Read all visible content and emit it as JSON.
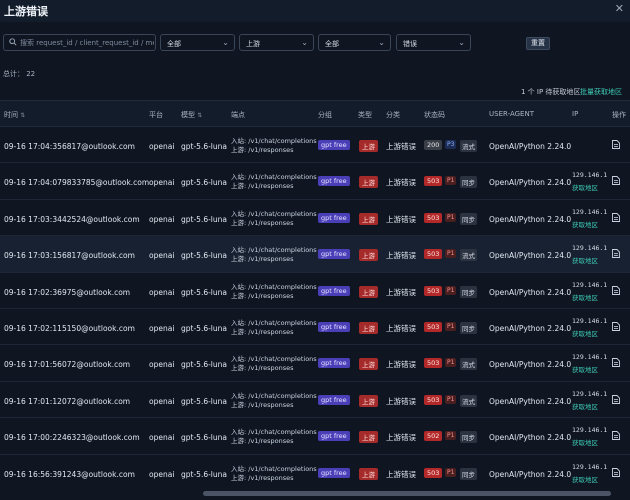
{
  "title": "上游错误",
  "filters": {
    "search_placeholder": "搜索 request_id / client_request_id / message",
    "select1": "全部",
    "select2": "上游",
    "select3": "全部",
    "select4": "错误",
    "reset_label": "重置"
  },
  "summary": {
    "total": "总计： 22",
    "ip_note": "1 个 IP 待获取地区",
    "batch_link": "批量获取地区"
  },
  "columns": {
    "time": "时间",
    "platform": "平台",
    "model": "模型",
    "endpoint": "端点",
    "group": "分组",
    "type": "类型",
    "category": "分类",
    "status": "状态码",
    "ua": "USER-AGENT",
    "ip": "IP",
    "ops": "操作"
  },
  "rows": [
    {
      "time": "09-16 17:04:35",
      "email": "6817@outlook.com",
      "platform": "openai",
      "model": "gpt-5.6-luna",
      "ep_in": "入站: /v1/chat/completions",
      "ep_up": "上游: /v1/responses",
      "group": "gpt free",
      "type": "上游",
      "category": "上游错误",
      "code": "200",
      "priority": "P3",
      "mode": "流式",
      "ua": "OpenAI/Python 2.24.0",
      "ip": "",
      "geo": ""
    },
    {
      "time": "09-16 17:04:07",
      "email": "9833785@outlook.com",
      "platform": "openai",
      "model": "gpt-5.6-luna",
      "ep_in": "入站: /v1/chat/completions",
      "ep_up": "上游: /v1/responses",
      "group": "gpt free",
      "type": "上游",
      "category": "上游错误",
      "code": "503",
      "priority": "P1",
      "mode": "同步",
      "ua": "OpenAI/Python 2.24.0",
      "ip": "129.146.1",
      "geo": "获取地区"
    },
    {
      "time": "09-16 17:03:34",
      "email": "42524@outlook.com",
      "platform": "openai",
      "model": "gpt-5.6-luna",
      "ep_in": "入站: /v1/chat/completions",
      "ep_up": "上游: /v1/responses",
      "group": "gpt free",
      "type": "上游",
      "category": "上游错误",
      "code": "503",
      "priority": "P1",
      "mode": "同步",
      "ua": "OpenAI/Python 2.24.0",
      "ip": "129.146.1",
      "geo": "获取地区"
    },
    {
      "time": "09-16 17:03:15",
      "email": "6817@outlook.com",
      "platform": "openai",
      "model": "gpt-5.6-luna",
      "ep_in": "入站: /v1/chat/completions",
      "ep_up": "上游: /v1/responses",
      "group": "gpt free",
      "type": "上游",
      "category": "上游错误",
      "code": "503",
      "priority": "P1",
      "mode": "流式",
      "ua": "OpenAI/Python 2.24.0",
      "ip": "129.146.1",
      "geo": "获取地区"
    },
    {
      "time": "09-16 17:02:36",
      "email": "975@outlook.com",
      "platform": "openai",
      "model": "gpt-5.6-luna",
      "ep_in": "入站: /v1/chat/completions",
      "ep_up": "上游: /v1/responses",
      "group": "gpt free",
      "type": "上游",
      "category": "上游错误",
      "code": "503",
      "priority": "P1",
      "mode": "同步",
      "ua": "OpenAI/Python 2.24.0",
      "ip": "129.146.1",
      "geo": "获取地区"
    },
    {
      "time": "09-16 17:02:11",
      "email": "5150@outlook.com",
      "platform": "openai",
      "model": "gpt-5.6-luna",
      "ep_in": "入站: /v1/chat/completions",
      "ep_up": "上游: /v1/responses",
      "group": "gpt free",
      "type": "上游",
      "category": "上游错误",
      "code": "503",
      "priority": "P1",
      "mode": "同步",
      "ua": "OpenAI/Python 2.24.0",
      "ip": "129.146.1",
      "geo": "获取地区"
    },
    {
      "time": "09-16 17:01:56",
      "email": "072@outlook.com",
      "platform": "openai",
      "model": "gpt-5.6-luna",
      "ep_in": "入站: /v1/chat/completions",
      "ep_up": "上游: /v1/responses",
      "group": "gpt free",
      "type": "上游",
      "category": "上游错误",
      "code": "503",
      "priority": "P1",
      "mode": "流式",
      "ua": "OpenAI/Python 2.24.0",
      "ip": "129.146.1",
      "geo": "获取地区"
    },
    {
      "time": "09-16 17:01:12",
      "email": "072@outlook.com",
      "platform": "openai",
      "model": "gpt-5.6-luna",
      "ep_in": "入站: /v1/chat/completions",
      "ep_up": "上游: /v1/responses",
      "group": "gpt free",
      "type": "上游",
      "category": "上游错误",
      "code": "503",
      "priority": "P1",
      "mode": "流式",
      "ua": "OpenAI/Python 2.24.0",
      "ip": "129.146.1",
      "geo": "获取地区"
    },
    {
      "time": "09-16 17:00:22",
      "email": "46323@outlook.com",
      "platform": "openai",
      "model": "gpt-5.6-luna",
      "ep_in": "入站: /v1/chat/completions",
      "ep_up": "上游: /v1/responses",
      "group": "gpt free",
      "type": "上游",
      "category": "上游错误",
      "code": "502",
      "priority": "P1",
      "mode": "同步",
      "ua": "OpenAI/Python 2.24.0",
      "ip": "129.146.1",
      "geo": "获取地区"
    },
    {
      "time": "09-16 16:56:39",
      "email": "1243@outlook.com",
      "platform": "openai",
      "model": "gpt-5.6-luna",
      "ep_in": "入站: /v1/chat/completions",
      "ep_up": "上游: /v1/responses",
      "group": "gpt free",
      "type": "上游",
      "category": "上游错误",
      "code": "503",
      "priority": "P1",
      "mode": "同步",
      "ua": "OpenAI/Python 2.24.0",
      "ip": "129.146.1",
      "geo": "获取地区"
    }
  ]
}
